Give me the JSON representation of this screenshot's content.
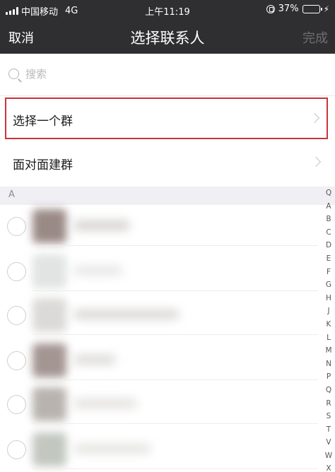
{
  "status_bar": {
    "carrier": "中国移动",
    "network": "4G",
    "time": "上午11:19",
    "battery": "37%",
    "battery_level": 0.37
  },
  "nav": {
    "cancel": "取消",
    "title": "选择联系人",
    "done": "完成"
  },
  "search": {
    "placeholder": "搜索"
  },
  "options": {
    "select_group": "选择一个群",
    "face_to_face": "面对面建群"
  },
  "section": {
    "header": "A"
  },
  "index_letters": [
    "Q",
    "A",
    "B",
    "C",
    "D",
    "E",
    "F",
    "G",
    "H",
    "J",
    "K",
    "L",
    "M",
    "N",
    "P",
    "Q",
    "R",
    "S",
    "T",
    "V",
    "W",
    "X"
  ]
}
